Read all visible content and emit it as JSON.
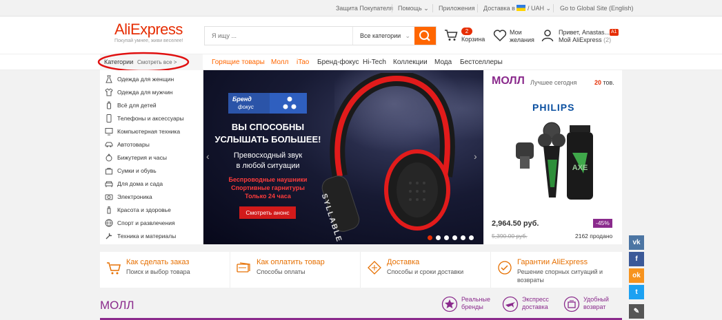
{
  "topbar": {
    "buyer_protection": "Защита Покупателя",
    "help": "Помощь",
    "apps": "Приложения",
    "delivery_to": "Доставка в",
    "currency": "UAH",
    "global_site": "Go to Global Site (English)"
  },
  "logo": {
    "brand": "AliExpress",
    "tagline": "Покупай умнее, живи веселее!"
  },
  "search": {
    "placeholder": "Я ищу ...",
    "category": "Все категории"
  },
  "cart": {
    "count": "2",
    "label": "Корзина"
  },
  "wishlist": {
    "line1": "Мои",
    "line2": "желания"
  },
  "account": {
    "greeting": "Привет, Anastas...",
    "badge": "A1",
    "line2": "Мой AliExpress",
    "count": "(2)"
  },
  "nav": {
    "categories": "Категории",
    "see_all": "Смотреть все >",
    "items": [
      "Горящие товары",
      "Молл",
      "iTao",
      "Бренд-фокус",
      "Hi-Tech",
      "Коллекции",
      "Мода",
      "Бестселлеры"
    ]
  },
  "categories": [
    {
      "label": "Одежда для женщин",
      "icon": "dress-icon"
    },
    {
      "label": "Одежда для мужчин",
      "icon": "shirt-icon"
    },
    {
      "label": "Всё для детей",
      "icon": "baby-bottle-icon"
    },
    {
      "label": "Телефоны и аксессуары",
      "icon": "phone-icon"
    },
    {
      "label": "Компьютерная техника",
      "icon": "monitor-icon"
    },
    {
      "label": "Автотовары",
      "icon": "car-icon"
    },
    {
      "label": "Бижутерия и часы",
      "icon": "ring-icon"
    },
    {
      "label": "Сумки и обувь",
      "icon": "bag-icon"
    },
    {
      "label": "Для дома и сада",
      "icon": "sofa-icon"
    },
    {
      "label": "Электроника",
      "icon": "camera-icon"
    },
    {
      "label": "Красота и здоровье",
      "icon": "beauty-icon"
    },
    {
      "label": "Спорт и развлечения",
      "icon": "ball-icon"
    },
    {
      "label": "Техника и материалы",
      "icon": "tools-icon"
    }
  ],
  "banner": {
    "brand_line1": "Бренд",
    "brand_line2": "фокус",
    "headline1": "ВЫ СПОСОБНЫ",
    "headline2": "УСЛЫШАТЬ БОЛЬШЕЕ!",
    "sub1": "Превосходный звук",
    "sub2": "в любой ситуации",
    "red1": "Беспроводные наушники",
    "red2": "Спортивные гарнитуры",
    "red3": "Только 24 часа",
    "cta": "Смотреть анонс",
    "headphone_text": "SYLLABLE",
    "active_dot": 0,
    "dots": 6
  },
  "mall": {
    "title": "МОЛЛ",
    "subtitle": "Лучшее сегодня",
    "count": "20",
    "count_suffix": "тов.",
    "brand": "PHILIPS",
    "price": "2,964.50 руб.",
    "discount": "-45%",
    "old_price": "5,390.00 руб.",
    "sold": "2162 продано"
  },
  "services": [
    {
      "title": "Как сделать заказ",
      "sub": "Поиск и выбор товара",
      "icon": "cart-icon"
    },
    {
      "title": "Как оплатить товар",
      "sub": "Способы оплаты",
      "icon": "payment-icon"
    },
    {
      "title": "Доставка",
      "sub": "Способы и сроки доставки",
      "icon": "delivery-icon"
    },
    {
      "title": "Гарантии AliExpress",
      "sub": "Решение спорных ситуаций и возвраты",
      "icon": "guarantee-icon"
    }
  ],
  "mall_section": {
    "title": "МОЛЛ",
    "features": [
      {
        "line1": "Реальные",
        "line2": "бренды",
        "icon": "star-badge-icon"
      },
      {
        "line1": "Экспресс",
        "line2": "доставка",
        "icon": "plane-icon"
      },
      {
        "line1": "Удобный",
        "line2": "возврат",
        "icon": "return-icon"
      }
    ]
  },
  "social": {
    "vk": "vk",
    "fb": "f",
    "ok": "ok",
    "tw": "t",
    "edit": "✎"
  },
  "colors": {
    "accent": "#f60",
    "brand_red": "#e62e04",
    "mall_purple": "#8a2a8c",
    "annotation_red": "#e01010"
  }
}
